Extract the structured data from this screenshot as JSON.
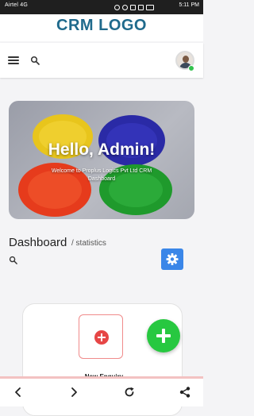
{
  "status_bar": {
    "left_text": "Airtel 4G",
    "time": "5:11 PM"
  },
  "header": {
    "logo_text": "CRM LOGO"
  },
  "toolbar": {
    "menu_icon": "hamburger-icon",
    "search_icon": "search-icon",
    "avatar_status": "online"
  },
  "hero": {
    "title": "Hello, Admin!",
    "subtitle": "Welcome to Proplus Logics Pvt Ltd CRM Dashboard"
  },
  "dashboard": {
    "title": "Dashboard",
    "subtitle": "/ statistics"
  },
  "card": {
    "new_enquiry_label": "New Enquiry"
  },
  "browser_nav": {
    "icons": [
      "back-icon",
      "forward-icon",
      "refresh-icon",
      "share-icon"
    ]
  },
  "colors": {
    "brand": "#1f6a8c",
    "settings_button": "#3a86e8",
    "fab": "#27c840",
    "enquiry_icon": "#e64646",
    "online": "#32c24d"
  }
}
